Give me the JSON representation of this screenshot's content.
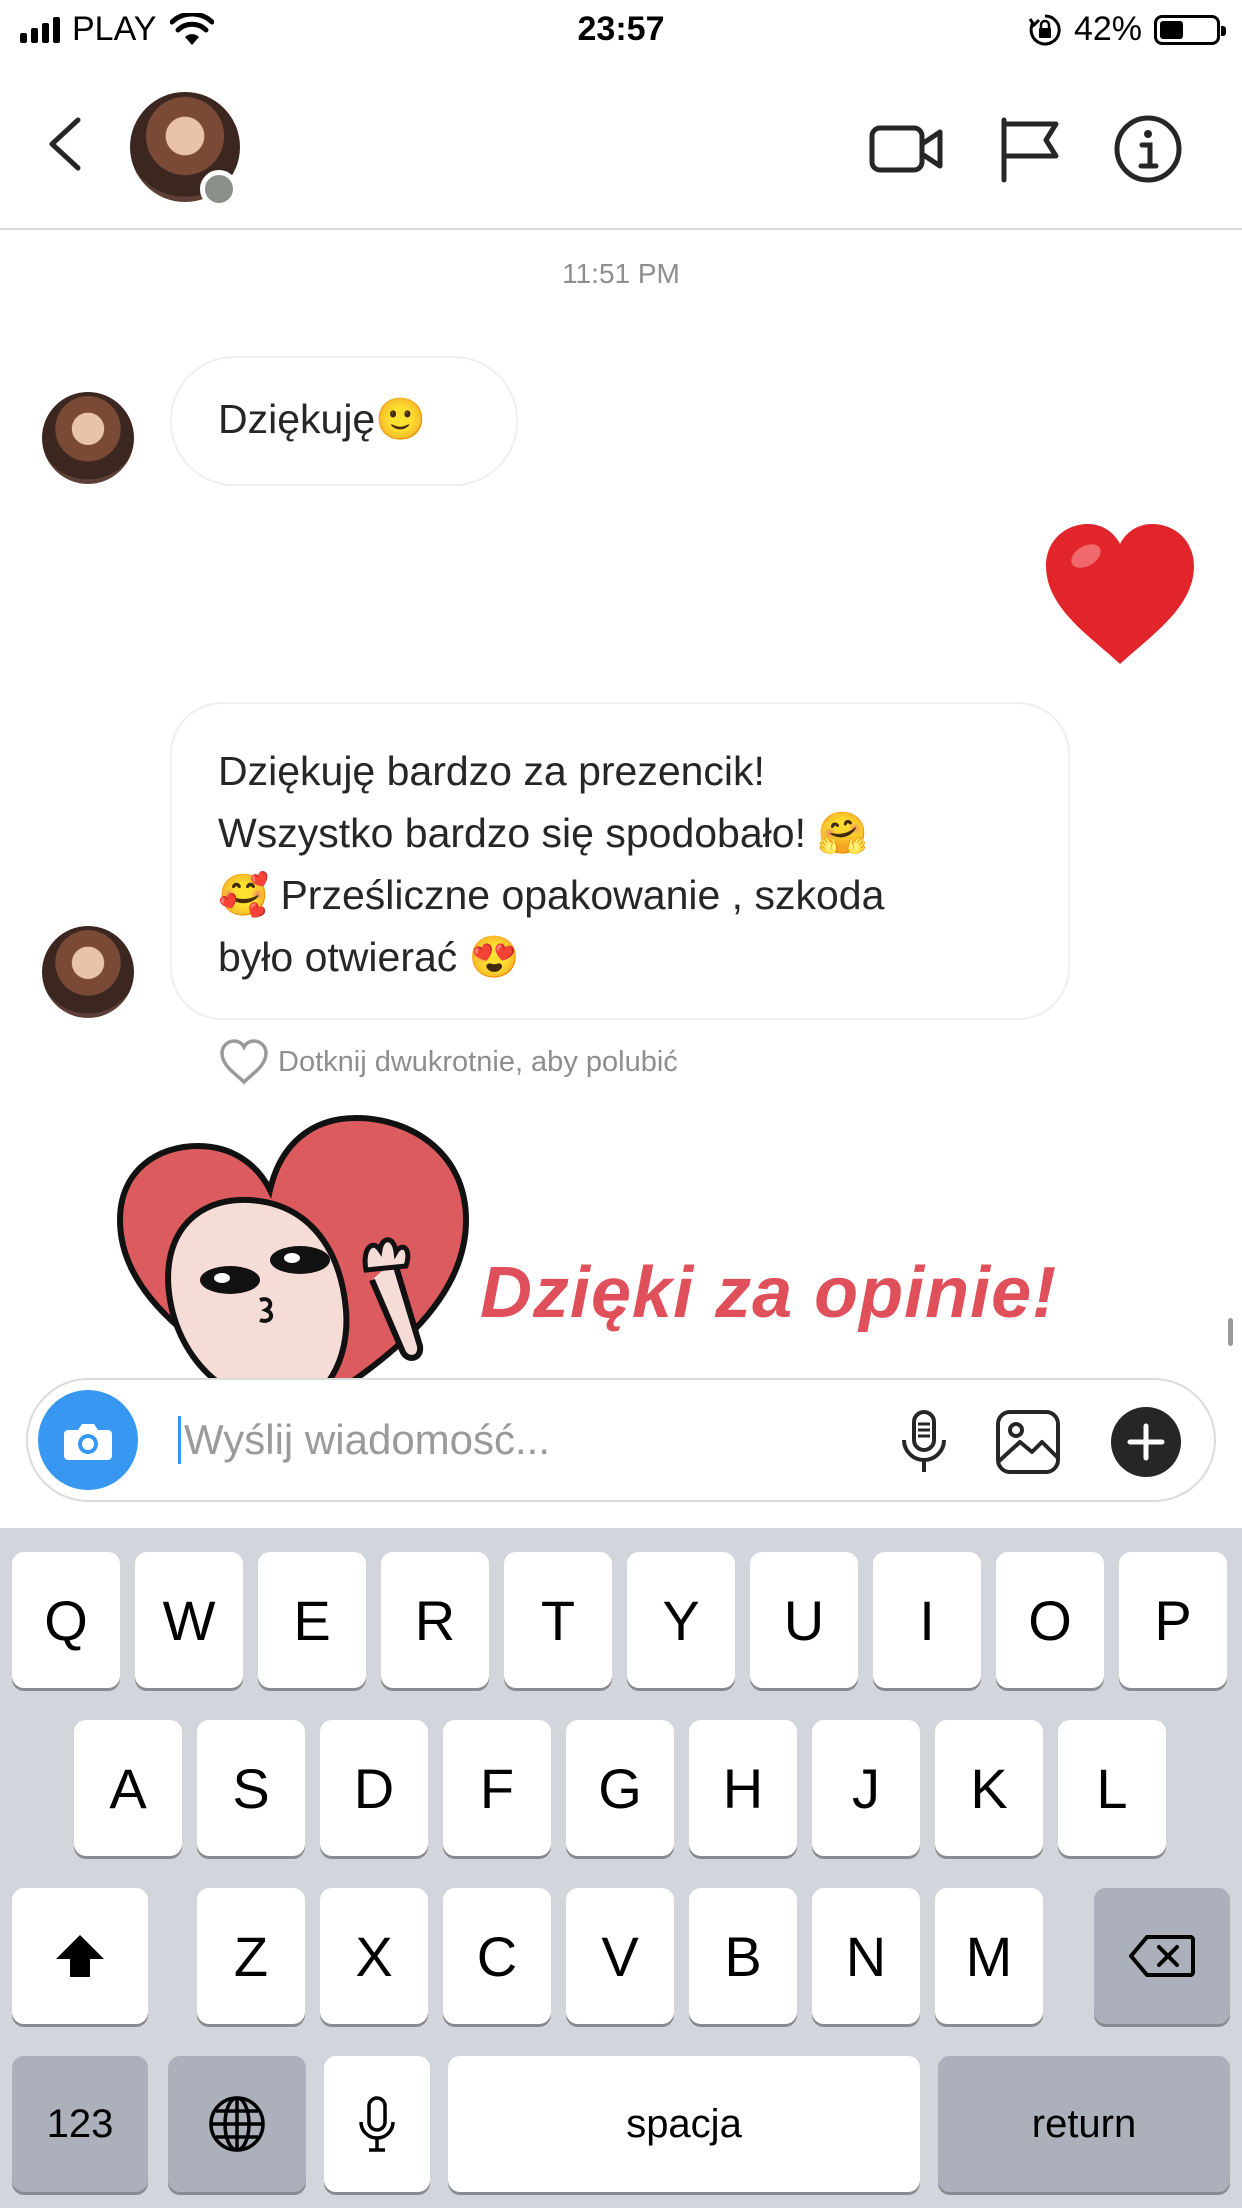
{
  "status_bar": {
    "carrier": "PLAY",
    "time": "23:57",
    "battery_percent": "42%",
    "battery_level": 0.42,
    "icons": [
      "signal-icon",
      "wifi-icon",
      "rotation-lock-icon",
      "battery-icon"
    ]
  },
  "header": {
    "icons": [
      "back-icon",
      "avatar",
      "video-call-icon",
      "flag-icon",
      "info-icon"
    ],
    "online_status_color": "#8a8f8a"
  },
  "chat": {
    "timestamp": "11:51 PM",
    "messages": [
      {
        "side": "left",
        "text": "Dziękuję🙂"
      },
      {
        "side": "right",
        "emoji": "❤️"
      },
      {
        "side": "left",
        "lines": [
          "Dziękuję bardzo za prezencik!",
          "Wszystko bardzo się spodobało! 🤗",
          "🥰 Prześliczne opakowanie , szkoda",
          "było otwierać 😍"
        ]
      }
    ],
    "like_hint": "Dotknij dwukrotnie, aby polubić"
  },
  "sticker": {
    "text": "Dzięki za opinie!",
    "color": "#e0505a"
  },
  "composer": {
    "placeholder": "Wyślij wiadomość...",
    "value": "",
    "accent": "#3897f0"
  },
  "keyboard": {
    "row1": [
      "Q",
      "W",
      "E",
      "R",
      "T",
      "Y",
      "U",
      "I",
      "O",
      "P"
    ],
    "row2": [
      "A",
      "S",
      "D",
      "F",
      "G",
      "H",
      "J",
      "K",
      "L"
    ],
    "row3": [
      "Z",
      "X",
      "C",
      "V",
      "B",
      "N",
      "M"
    ],
    "numbers_label": "123",
    "space_label": "spacja",
    "return_label": "return"
  }
}
